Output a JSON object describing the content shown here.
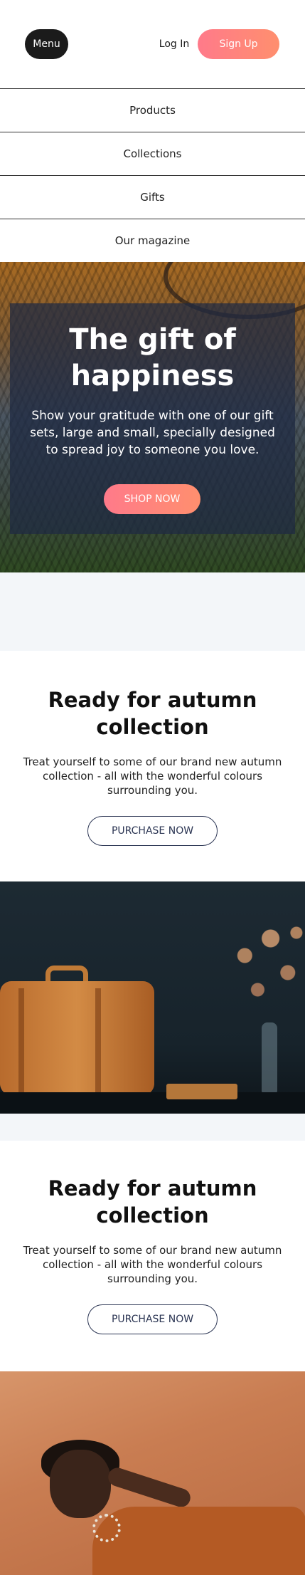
{
  "header": {
    "menu_label": "Menu",
    "login_label": "Log In",
    "signup_label": "Sign Up"
  },
  "nav": {
    "items": [
      {
        "label": "Products"
      },
      {
        "label": "Collections"
      },
      {
        "label": "Gifts"
      },
      {
        "label": "Our magazine"
      }
    ]
  },
  "hero": {
    "title": "The gift of happiness",
    "text": "Show your gratitude with one of our gift sets, large and small, specially designed to spread joy to someone you love.",
    "button_label": "SHOP NOW"
  },
  "sections": [
    {
      "title": "Ready for autumn collection",
      "text": "Treat yourself to some of our brand new autumn collection - all with the wonderful colours surrounding you.",
      "button_label": "PURCHASE NOW"
    },
    {
      "title": "Ready for autumn collection",
      "text": "Treat yourself to some of our brand new autumn collection - all with the wonderful colours surrounding you.",
      "button_label": "PURCHASE NOW"
    }
  ],
  "colors": {
    "accent_gradient_start": "#ff7a8a",
    "accent_gradient_end": "#ff8f6e",
    "dark_button": "#1b1b1b",
    "outline_button": "#2b3553",
    "spacer_bg": "#f3f6f9"
  }
}
